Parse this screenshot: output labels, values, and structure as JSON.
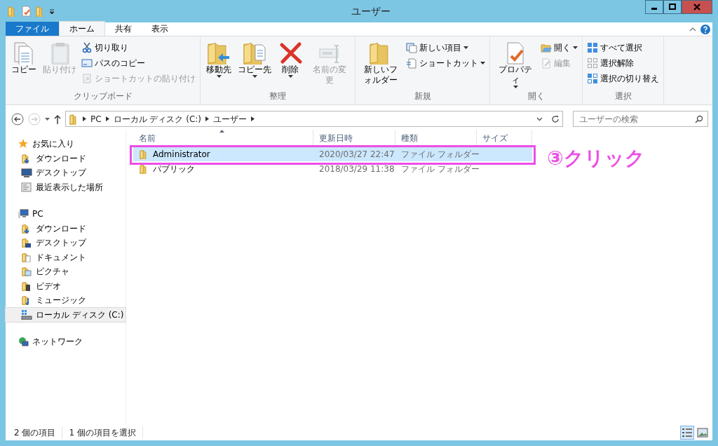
{
  "window": {
    "title": "ユーザー"
  },
  "ribbon_tabs": [
    {
      "label": "ファイル",
      "kind": "file",
      "selected": false
    },
    {
      "label": "ホーム",
      "kind": "tab",
      "selected": true
    },
    {
      "label": "共有",
      "kind": "tab",
      "selected": false
    },
    {
      "label": "表示",
      "kind": "tab",
      "selected": false
    }
  ],
  "ribbon_groups": [
    {
      "label": "クリップボード",
      "items": [
        {
          "label": "コピー",
          "kind": "large",
          "disabled": false,
          "dropdown": false
        },
        {
          "label": "貼り付け",
          "kind": "large",
          "disabled": true,
          "dropdown": false
        },
        {
          "label": "切り取り",
          "kind": "small",
          "disabled": false,
          "dropdown": false
        },
        {
          "label": "パスのコピー",
          "kind": "small",
          "disabled": false,
          "dropdown": false
        },
        {
          "label": "ショートカットの貼り付け",
          "kind": "small",
          "disabled": true,
          "dropdown": false
        }
      ]
    },
    {
      "label": "整理",
      "items": [
        {
          "label": "移動先",
          "kind": "large",
          "disabled": false,
          "dropdown": true
        },
        {
          "label": "コピー先",
          "kind": "large",
          "disabled": false,
          "dropdown": true
        },
        {
          "label": "削除",
          "kind": "large",
          "disabled": false,
          "dropdown": true
        },
        {
          "label": "名前の変更",
          "kind": "large",
          "disabled": true,
          "dropdown": false
        }
      ]
    },
    {
      "label": "新規",
      "items": [
        {
          "label": "新しいフォルダー",
          "kind": "large",
          "disabled": false,
          "dropdown": false
        },
        {
          "label": "新しい項目",
          "kind": "small",
          "disabled": false,
          "dropdown": true
        },
        {
          "label": "ショートカット",
          "kind": "small",
          "disabled": false,
          "dropdown": true
        }
      ]
    },
    {
      "label": "開く",
      "items": [
        {
          "label": "プロパティ",
          "kind": "large",
          "disabled": false,
          "dropdown": true
        },
        {
          "label": "開く",
          "kind": "small",
          "disabled": false,
          "dropdown": true
        },
        {
          "label": "編集",
          "kind": "small",
          "disabled": true,
          "dropdown": false
        }
      ]
    },
    {
      "label": "選択",
      "items": [
        {
          "label": "すべて選択",
          "kind": "small",
          "disabled": false,
          "dropdown": false
        },
        {
          "label": "選択解除",
          "kind": "small",
          "disabled": false,
          "dropdown": false
        },
        {
          "label": "選択の切り替え",
          "kind": "small",
          "disabled": false,
          "dropdown": false
        }
      ]
    }
  ],
  "address": {
    "path": [
      "PC",
      "ローカル ディスク (C:)",
      "ユーザー"
    ],
    "search": {
      "placeholder": "ユーザーの検索"
    }
  },
  "nav": [
    {
      "label": "お気に入り",
      "selected": false,
      "children": [
        {
          "label": "ダウンロード",
          "selected": false
        },
        {
          "label": "デスクトップ",
          "selected": false
        },
        {
          "label": "最近表示した場所",
          "selected": false
        }
      ]
    },
    {
      "label": "PC",
      "selected": false,
      "children": [
        {
          "label": "ダウンロード",
          "selected": false
        },
        {
          "label": "デスクトップ",
          "selected": false
        },
        {
          "label": "ドキュメント",
          "selected": false
        },
        {
          "label": "ピクチャ",
          "selected": false
        },
        {
          "label": "ビデオ",
          "selected": false
        },
        {
          "label": "ミュージック",
          "selected": false
        },
        {
          "label": "ローカル ディスク (C:)",
          "selected": true
        }
      ]
    },
    {
      "label": "ネットワーク",
      "selected": false
    }
  ],
  "table": {
    "columns": [
      "名前",
      "更新日時",
      "種類",
      "サイズ"
    ],
    "rows": [
      {
        "name": "Administrator",
        "modified": "2020/03/27 22:47",
        "type": "ファイル フォルダー",
        "selected": true
      },
      {
        "name": "パブリック",
        "modified": "2018/03/29 11:38",
        "type": "ファイル フォルダー",
        "selected": false
      }
    ]
  },
  "annotation": {
    "text": "③クリック"
  },
  "status_bar": {
    "items": [
      "2 個の項目",
      "1 個の項目を選択"
    ],
    "views": [
      {
        "kind": "details",
        "selected": true
      },
      {
        "kind": "large_icons",
        "selected": false
      }
    ]
  }
}
